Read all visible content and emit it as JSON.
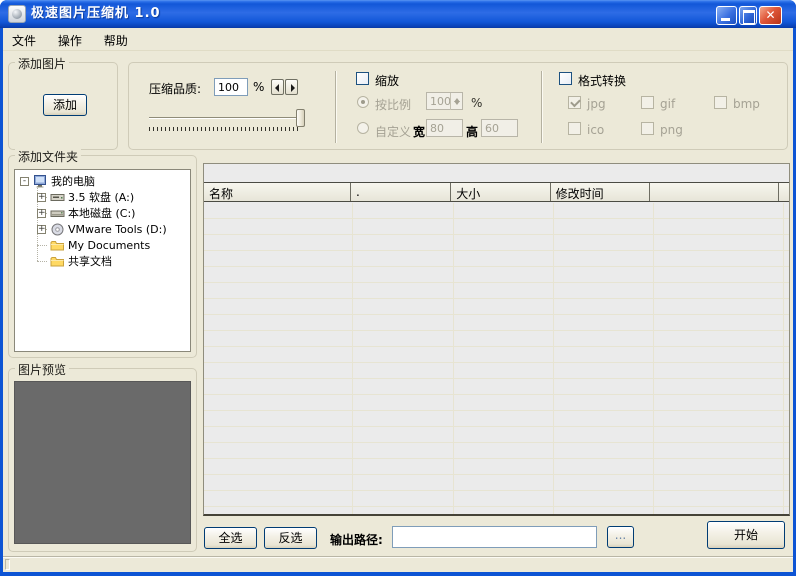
{
  "window": {
    "title": "极速图片压缩机 1.0"
  },
  "menu": {
    "items": [
      "文件",
      "操作",
      "帮助"
    ]
  },
  "panels": {
    "add_image": {
      "label": "添加图片",
      "add_button": "添加"
    },
    "quality": {
      "label": "压缩品质:",
      "value": "100",
      "unit": "%"
    },
    "scale": {
      "label": "缩放",
      "proportional_label": "按比例",
      "proportional_value": "100",
      "proportional_unit": "%",
      "proportional_selected": true,
      "custom_label": "自定义",
      "width_label": "宽",
      "width_value": "80",
      "height_label": "高",
      "height_value": "60"
    },
    "format": {
      "label": "格式转换",
      "options": [
        {
          "label": "jpg",
          "checked": true
        },
        {
          "label": "gif",
          "checked": false
        },
        {
          "label": "bmp",
          "checked": false
        },
        {
          "label": "ico",
          "checked": false
        },
        {
          "label": "png",
          "checked": false
        }
      ]
    },
    "folders": {
      "label": "添加文件夹",
      "tree": [
        {
          "label": "我的电脑",
          "icon": "computer",
          "toggle": "-"
        },
        {
          "label": "3.5 软盘 (A:)",
          "icon": "floppy",
          "toggle": "+"
        },
        {
          "label": "本地磁盘 (C:)",
          "icon": "harddisk",
          "toggle": "+"
        },
        {
          "label": "VMware Tools (D:)",
          "icon": "cdrom",
          "toggle": "+"
        },
        {
          "label": "My Documents",
          "icon": "folder",
          "toggle": ""
        },
        {
          "label": "共享文档",
          "icon": "folder",
          "toggle": ""
        }
      ]
    },
    "preview": {
      "label": "图片预览"
    }
  },
  "table": {
    "columns": [
      "名称",
      ".",
      "大小",
      "修改时间",
      ""
    ]
  },
  "bottom": {
    "select_all": "全选",
    "invert": "反选",
    "output_label": "输出路径:",
    "output_value": "",
    "browse": "...",
    "start": "开始"
  },
  "colors": {
    "titlebar_blue": "#1257d8",
    "client_bg": "#ece9d8",
    "list_bg": "#ebebeb",
    "preview_bg": "#6a6a6a",
    "button_border": "#003c74",
    "close_red": "#d04022"
  }
}
